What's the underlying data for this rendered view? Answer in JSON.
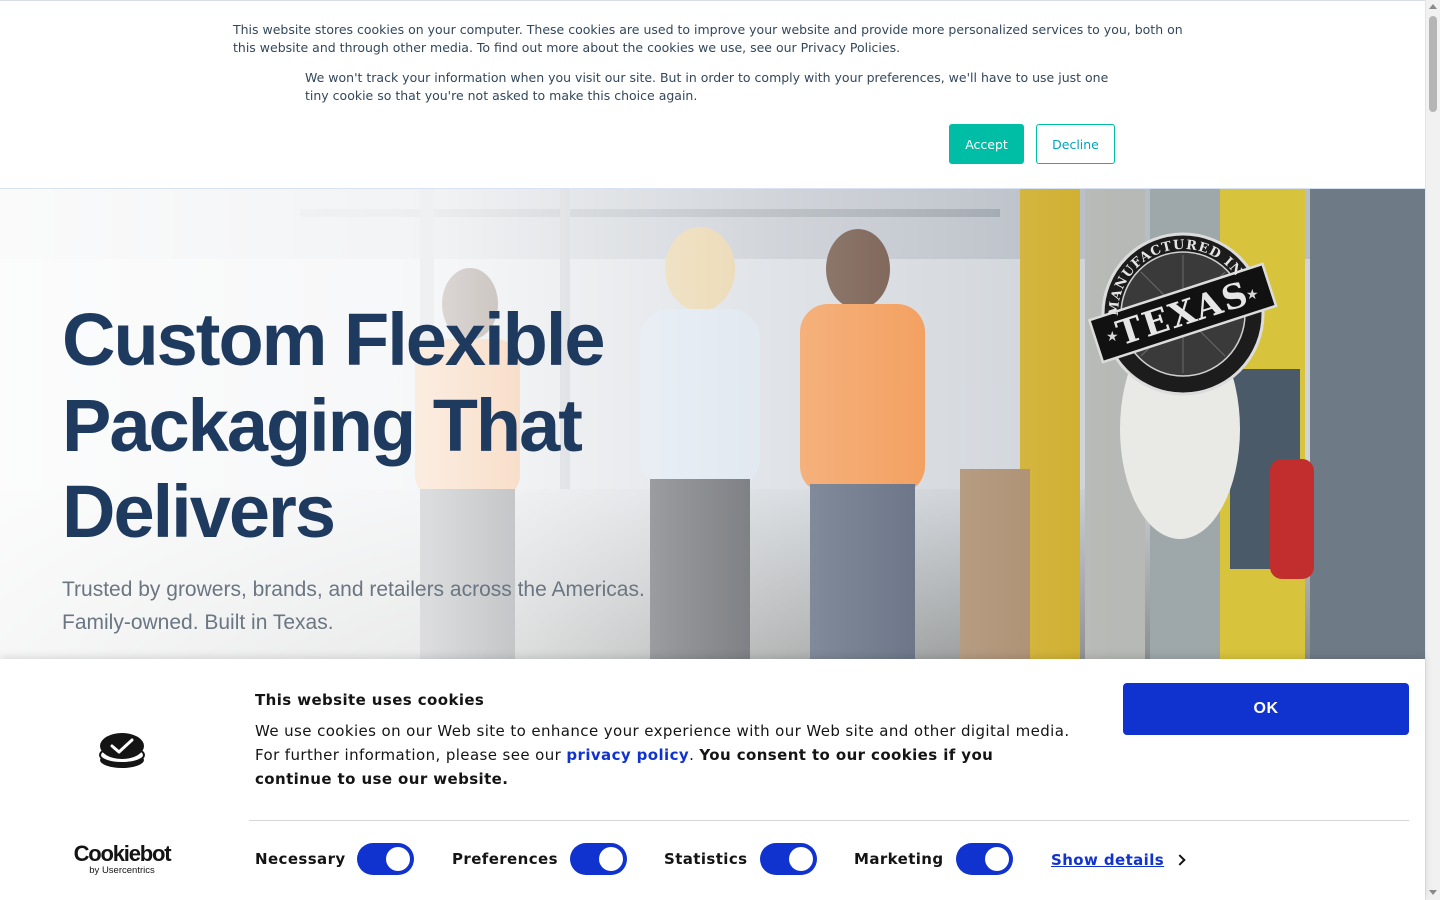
{
  "top_banner": {
    "paragraph_1": "This website stores cookies on your computer. These cookies are used to improve your website and provide more personalized services to you, both on this website and through other media. To find out more about the cookies we use, see our Privacy Policies.",
    "paragraph_2": "We won't track your information when you visit our site. But in order to comply with your preferences, we'll have to use just one tiny cookie so that you're not asked to make this choice again.",
    "accept_label": "Accept",
    "decline_label": "Decline",
    "accent_color": "#00bda5"
  },
  "hero": {
    "title": "Custom Flexible Packaging That Delivers",
    "subtitle_line_1": "Trusted by growers, brands, and retailers across the Americas.",
    "subtitle_line_2": "Family-owned. Built in Texas.",
    "title_color": "#1f3a5f",
    "seal": {
      "top_text": "MANUFACTURED IN",
      "main_text": "TEXAS"
    }
  },
  "cookiebot": {
    "title": "This website uses cookies",
    "body_text": "We use cookies on our Web site to enhance your experience with our Web site and other digital media. For further information, please see our ",
    "privacy_link": "privacy policy",
    "body_separator": ". ",
    "consent_text": "You consent to our cookies if you continue to use our website.",
    "ok_label": "OK",
    "logo_text": "Cookiebot",
    "logo_sub": "by Usercentrics",
    "toggles": [
      {
        "label": "Necessary",
        "checked": true
      },
      {
        "label": "Preferences",
        "checked": true
      },
      {
        "label": "Statistics",
        "checked": true
      },
      {
        "label": "Marketing",
        "checked": true
      }
    ],
    "show_details_label": "Show details",
    "brand_color": "#1032cf"
  }
}
